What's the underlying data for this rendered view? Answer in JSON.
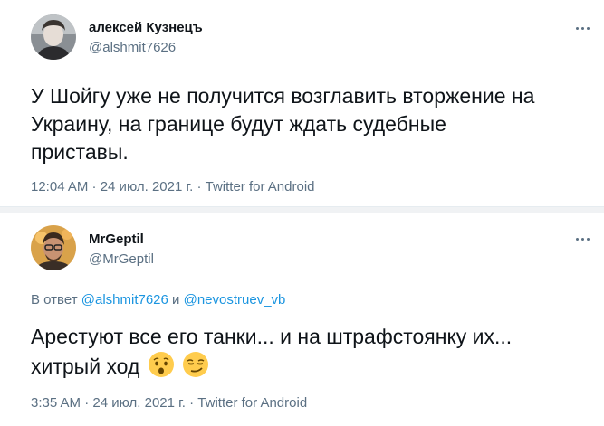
{
  "tweet1": {
    "name": "алексей Кузнецъ",
    "handle": "@alshmit7626",
    "text_line1": "У Шойгу уже не получится возглавить вторжение на",
    "text_line2": "Украину, на границе будут ждать судебные",
    "text_line3": "приставы.",
    "meta": "12:04 AM · 24 июл. 2021 г. · Twitter for Android"
  },
  "tweet2": {
    "name": "MrGeptil",
    "handle": "@MrGeptil",
    "reply_prefix": "В ответ",
    "reply_to_1": "@alshmit7626",
    "reply_and": "и",
    "reply_to_2": "@nevostruev_vb",
    "text_line1": "Арестуют все его танки... и на штрафстоянку их...",
    "text_line2": "хитрый ход",
    "emojis": [
      "hushed-face-icon",
      "smirking-face-icon"
    ],
    "meta": "3:35 AM · 24 июл. 2021 г. · Twitter for Android"
  }
}
